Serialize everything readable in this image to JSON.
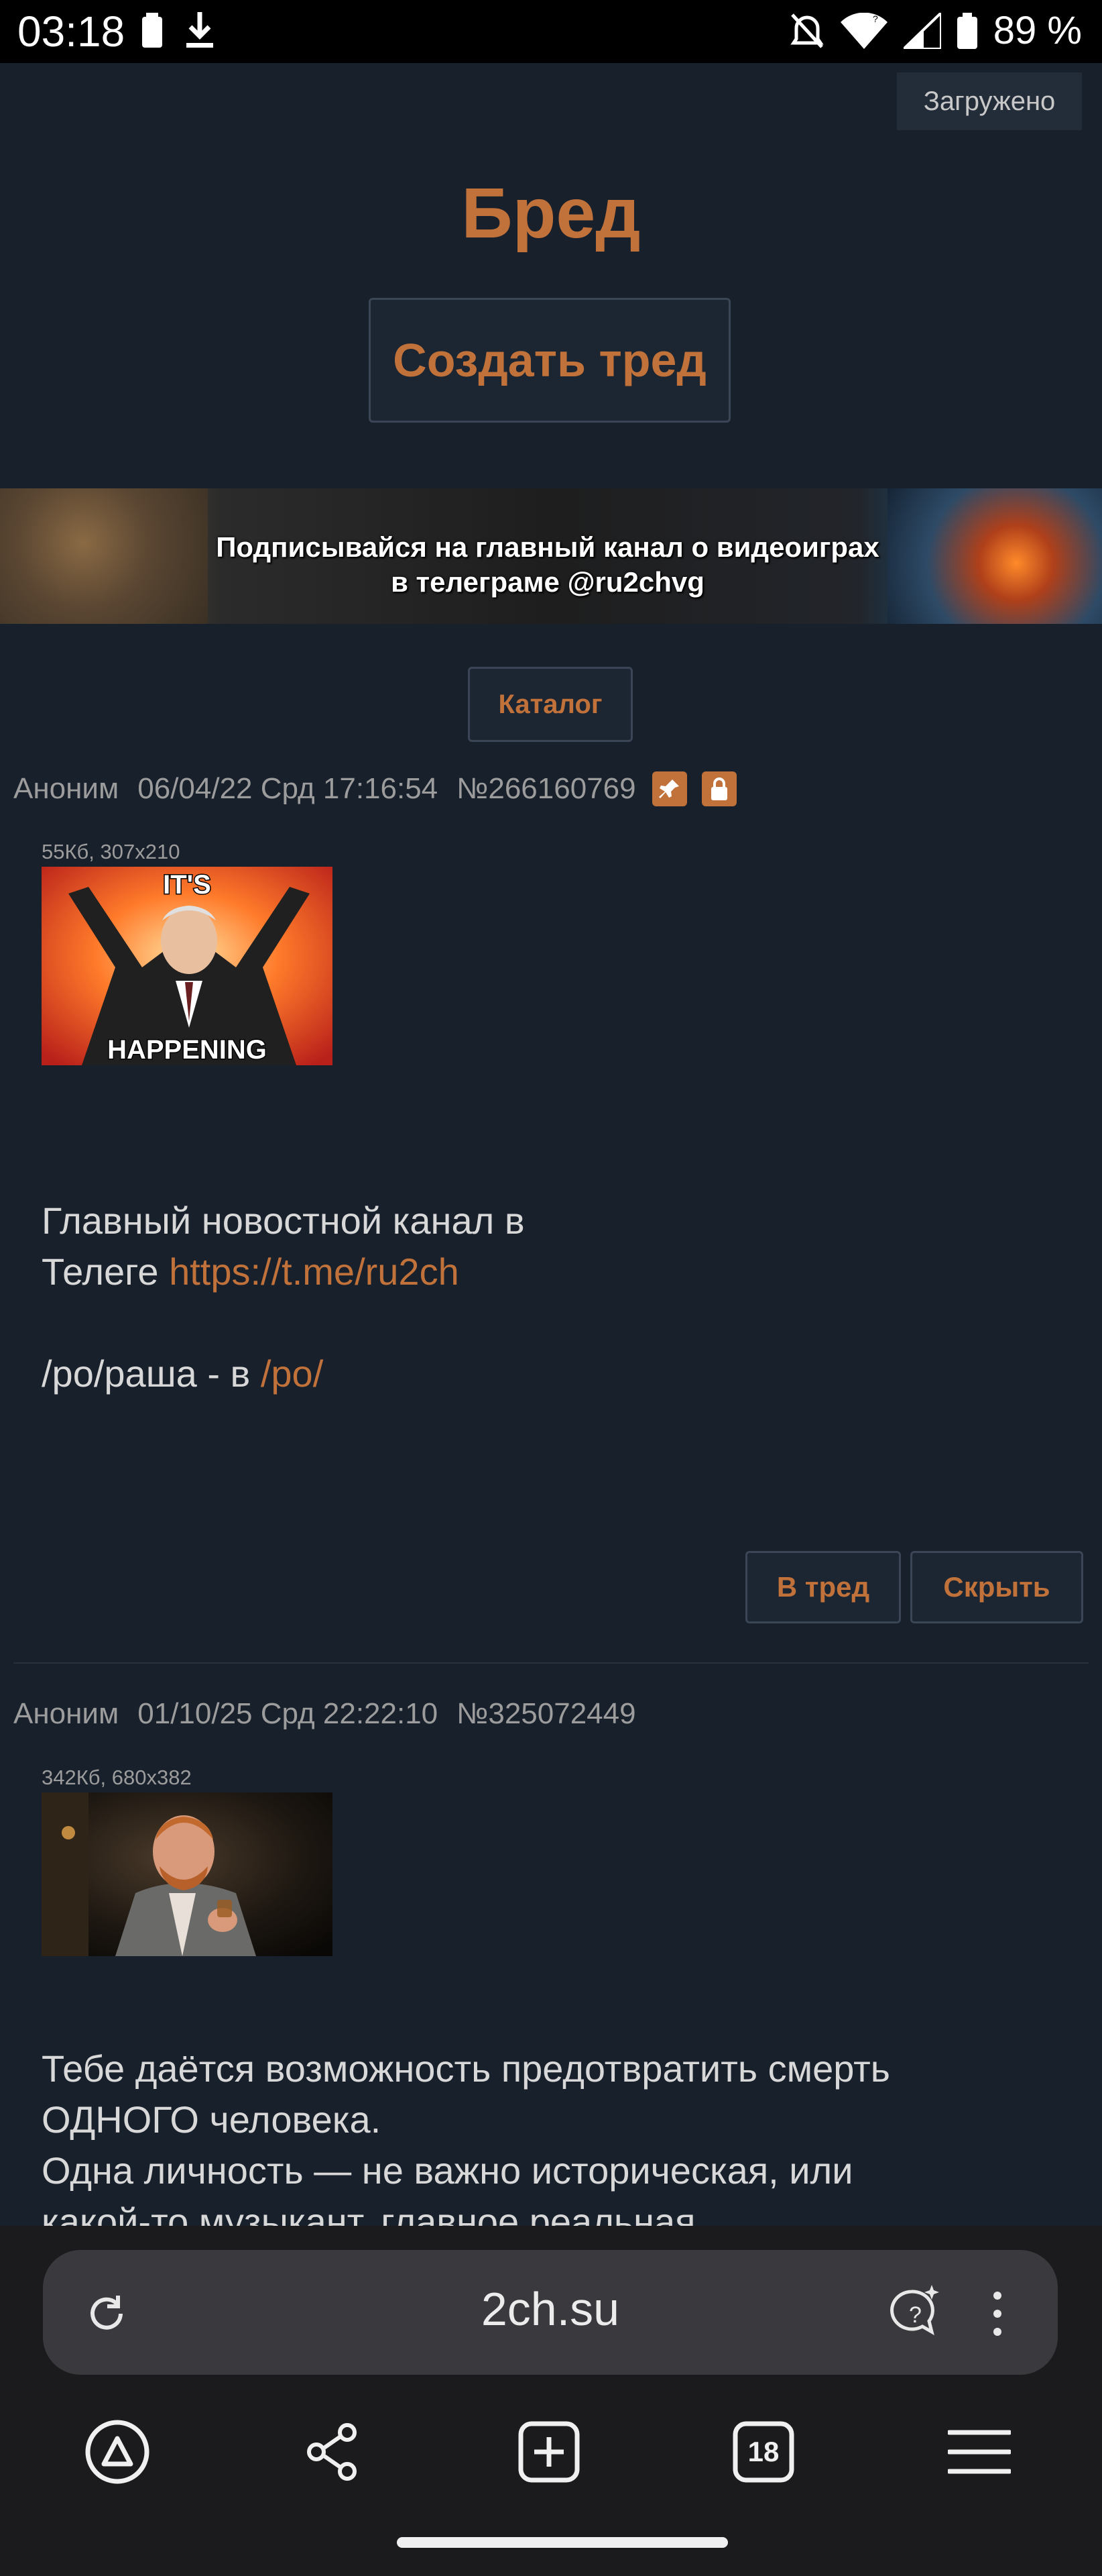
{
  "status_bar": {
    "time": "03:18",
    "battery_pct": "89 %"
  },
  "page": {
    "loaded_badge": "Загружено",
    "board_title": "Бред",
    "create_thread_label": "Создать тред",
    "banner_text_line1": "Подписывайся на главный канал о видеоиграх",
    "banner_text_line2": "в телеграме @ru2chvg",
    "catalog_label": "Каталог"
  },
  "posts": [
    {
      "author": "Аноним",
      "date": "06/04/22 Срд 17:16:54",
      "number": "№266160769",
      "file_meta": "55Кб, 307x210",
      "image_caption_top": "IT'S",
      "image_caption_bottom": "HAPPENING",
      "text_line1": "Главный новостной канал в",
      "text_line2_prefix": "Телеге ",
      "text_link": "https://t.me/ru2ch",
      "text_line3_prefix": "/po/раша - в ",
      "text_line3_link": "/po/",
      "btn_thread": "В тред",
      "btn_hide": "Скрыть"
    },
    {
      "author": "Аноним",
      "date": "01/10/25 Срд 22:22:10",
      "number": "№325072449",
      "file_meta": "342Кб, 680x382",
      "text_line1": "Тебе даётся возможность предотвратить смерть",
      "text_line2": "ОДНОГО человека.",
      "text_line3": "Одна личность — не важно историческая, или",
      "text_line4": "какой-то музыкант, главное реальная"
    }
  ],
  "browser": {
    "url": "2ch.su",
    "tabs_count": "18"
  }
}
